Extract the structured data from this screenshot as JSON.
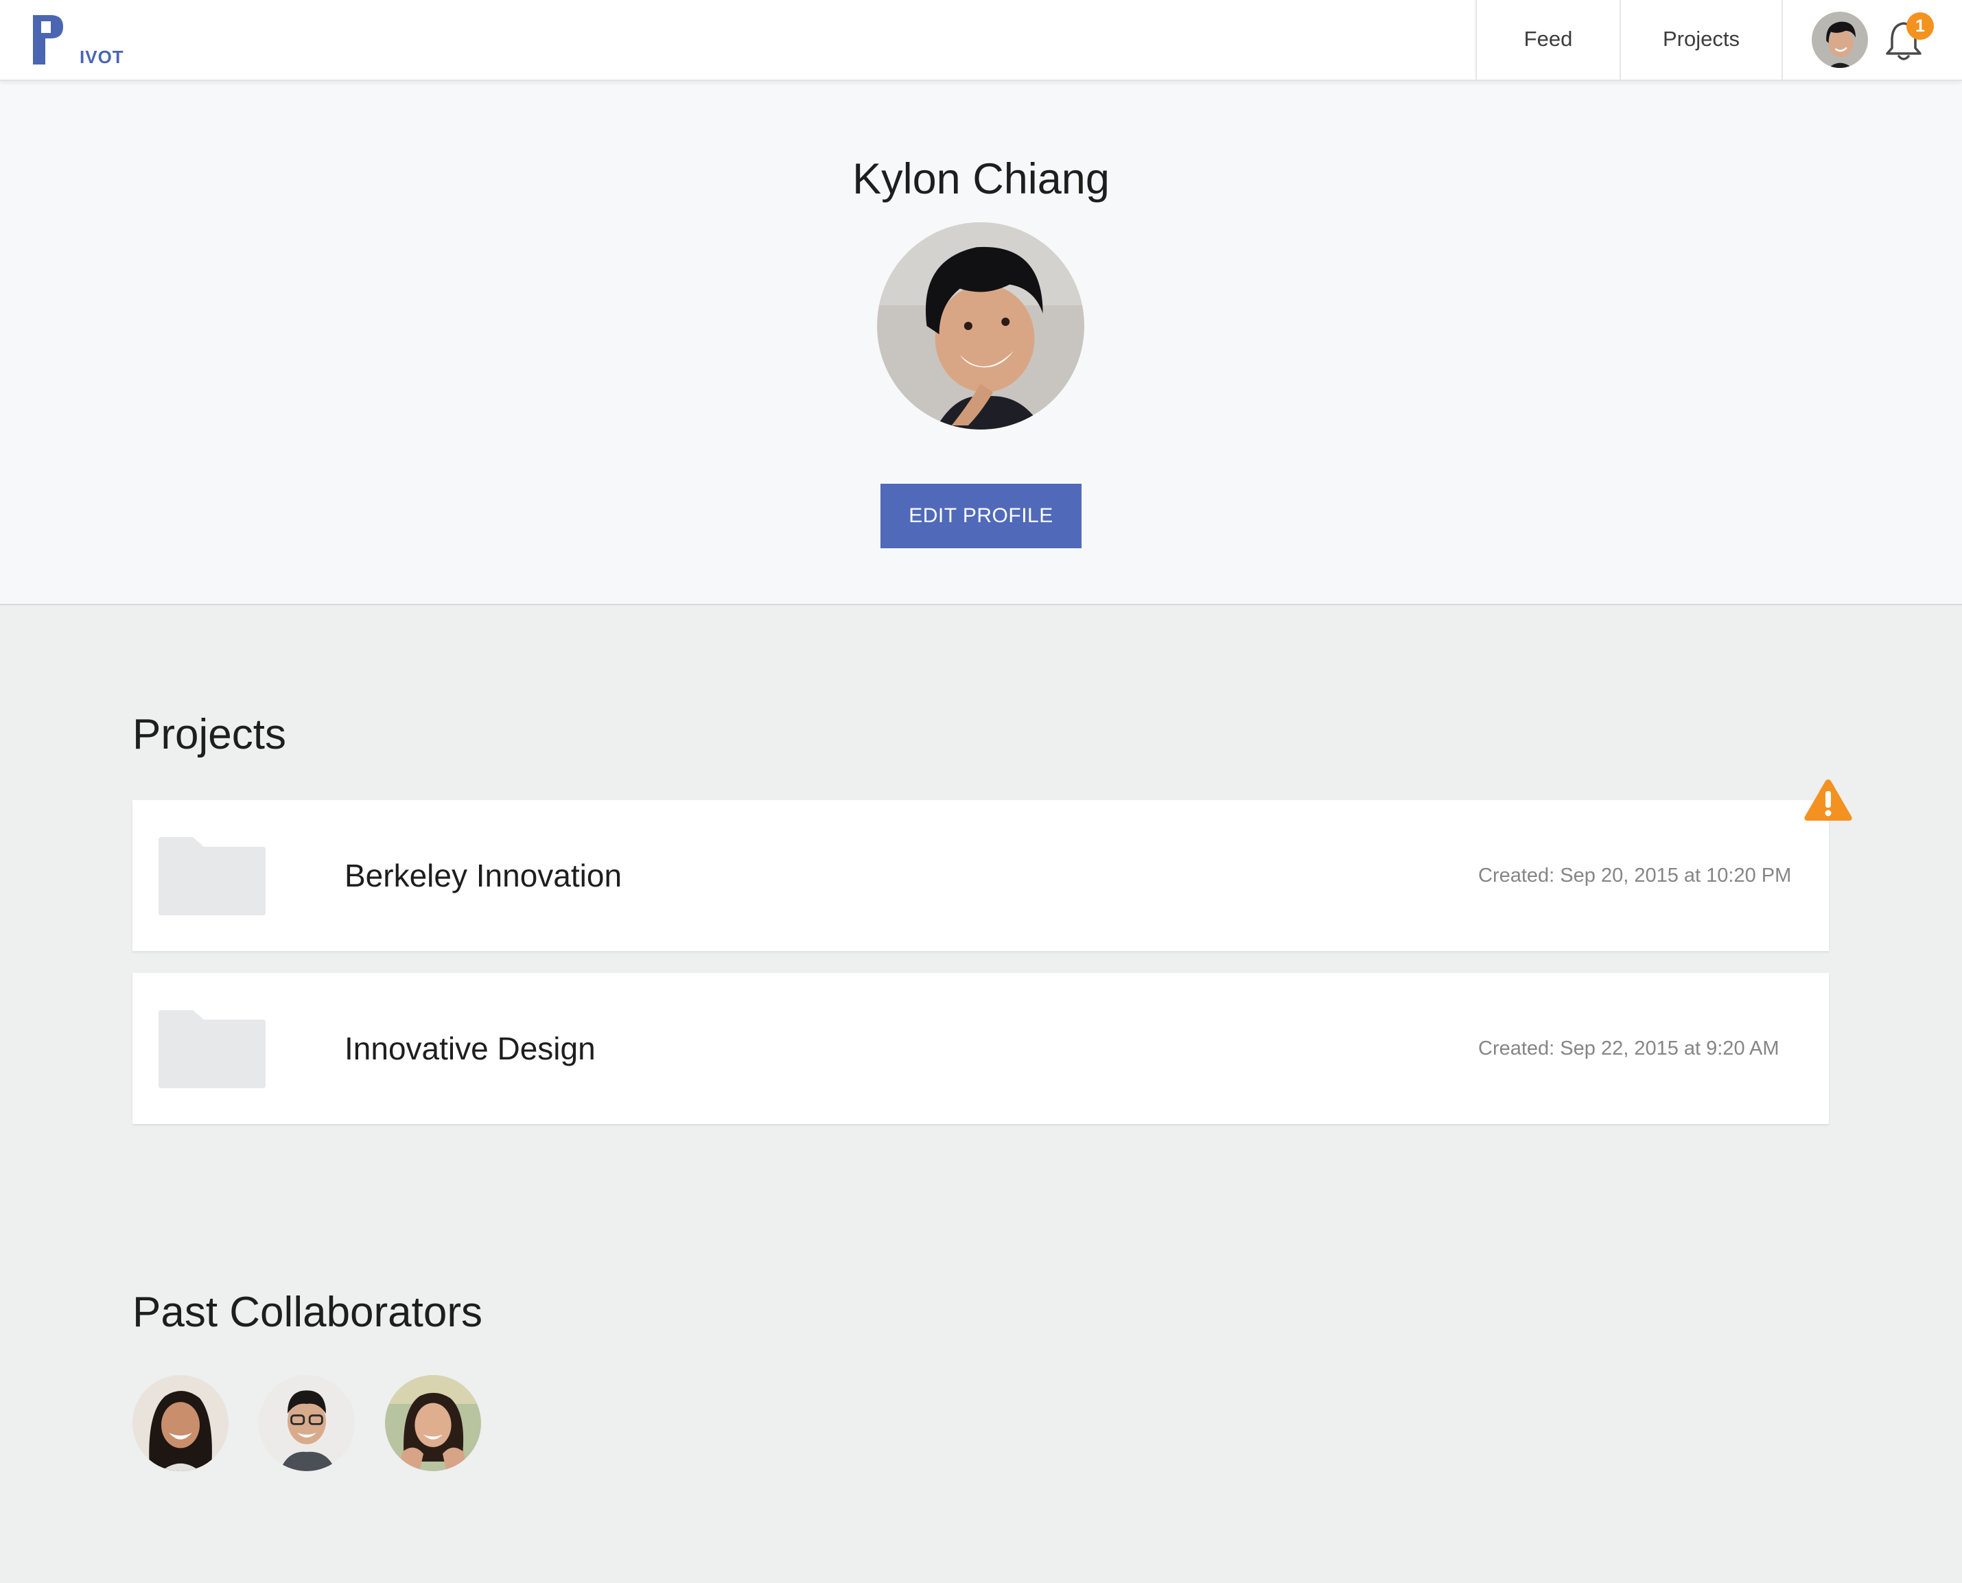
{
  "brand": {
    "logo_text": "IVOT",
    "logo_color": "#4a66b2"
  },
  "nav": {
    "feed_label": "Feed",
    "projects_label": "Projects",
    "notification_count": "1",
    "badge_color": "#f4921f"
  },
  "profile": {
    "name": "Kylon Chiang",
    "edit_button_label": "EDIT PROFILE",
    "button_color": "#506ab9"
  },
  "projects_section": {
    "title": "Projects",
    "items": [
      {
        "name": "Berkeley Innovation",
        "created": "Created: Sep 20, 2015 at 10:20 PM",
        "icon": "folder-icon",
        "warning_icon": "warning-icon"
      },
      {
        "name": "Innovative Design",
        "created": "Created: Sep 22, 2015 at 9:20 AM",
        "icon": "folder-icon"
      }
    ]
  },
  "collaborators_section": {
    "title": "Past Collaborators",
    "avatar_count": 3
  }
}
